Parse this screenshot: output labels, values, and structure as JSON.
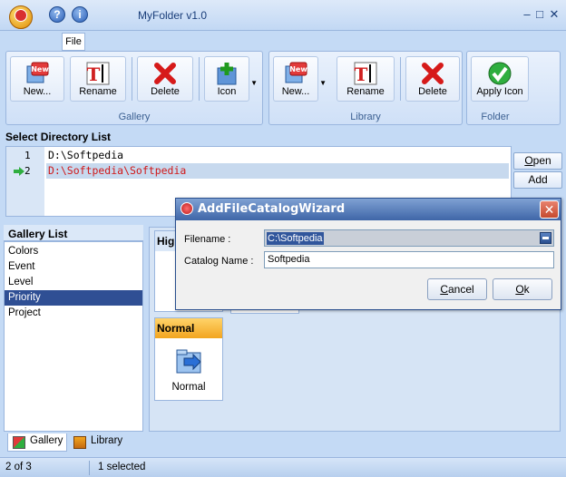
{
  "app": {
    "title": "MyFolder v1.0",
    "file_tab": "File"
  },
  "ribbon": {
    "gallery": {
      "label": "Gallery",
      "buttons": [
        {
          "label": "New..."
        },
        {
          "label": "Rename"
        },
        {
          "label": "Delete"
        },
        {
          "label": "Icon"
        }
      ]
    },
    "library": {
      "label": "Library",
      "buttons": [
        {
          "label": "New..."
        },
        {
          "label": "Rename"
        },
        {
          "label": "Delete"
        }
      ]
    },
    "folder": {
      "label": "Folder",
      "buttons": [
        {
          "label": "Apply Icon"
        }
      ]
    }
  },
  "directory": {
    "header": "Select Directory List",
    "rows": [
      {
        "num": "1",
        "path": "D:\\Softpedia"
      },
      {
        "num": "2",
        "path": "D:\\Softpedia\\Softpedia"
      }
    ],
    "buttons": {
      "open": "Open",
      "add": "Add"
    }
  },
  "gallery_list": {
    "header": "Gallery List",
    "items": [
      "Colors",
      "Event",
      "Level",
      "Priority",
      "Project"
    ],
    "selected": "Priority"
  },
  "cards": {
    "high_header": "Hig",
    "normal_header": "Normal",
    "normal_label": "Normal"
  },
  "tabs": [
    "Gallery",
    "Library"
  ],
  "status": {
    "position": "2 of 3",
    "selection": "1 selected"
  },
  "dialog": {
    "title": "AddFileCatalogWizard",
    "filename_label": "Filename :",
    "filename_value": "C:\\Softpedia",
    "catalog_label": "Catalog Name :",
    "catalog_value": "Softpedia",
    "cancel": "Cancel",
    "ok": "Ok"
  },
  "colors": {
    "accent": "#2f4f94",
    "ribbon_border": "#9ab6de",
    "selected_path": "#d01818",
    "normal_header": "#f2a51f"
  }
}
